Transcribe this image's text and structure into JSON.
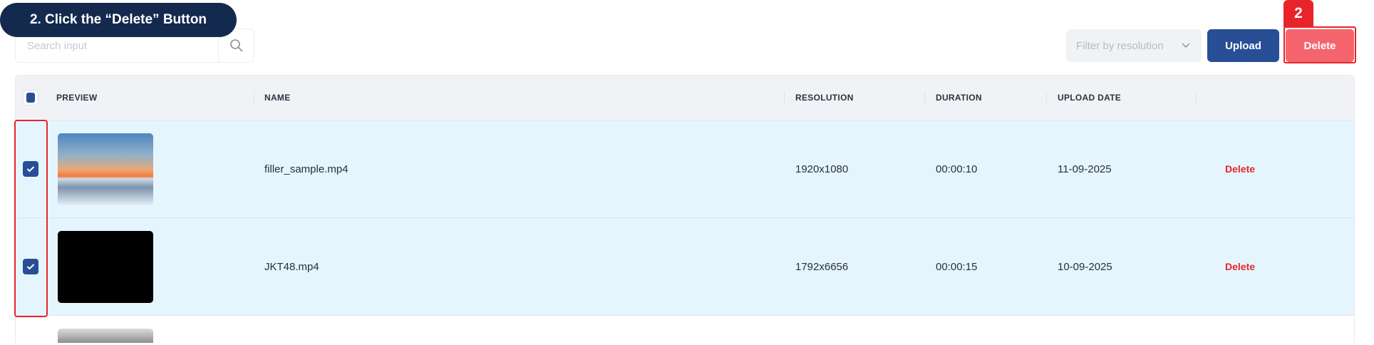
{
  "tooltip": "2. Click the “Delete” Button",
  "badge": "2",
  "search": {
    "placeholder": "Search input",
    "value": ""
  },
  "filter": {
    "placeholder": "Filter by resolution"
  },
  "toolbar": {
    "upload_label": "Upload",
    "delete_label": "Delete"
  },
  "table": {
    "headers": {
      "preview": "PREVIEW",
      "name": "NAME",
      "resolution": "RESOLUTION",
      "duration": "DURATION",
      "upload_date": "UPLOAD DATE"
    },
    "rows": [
      {
        "name": "filler_sample.mp4",
        "resolution": "1920x1080",
        "duration": "00:00:10",
        "upload_date": "11-09-2025",
        "action": "Delete",
        "checked": true
      },
      {
        "name": "JKT48.mp4",
        "resolution": "1792x6656",
        "duration": "00:00:15",
        "upload_date": "10-09-2025",
        "action": "Delete",
        "checked": true
      }
    ]
  },
  "colors": {
    "primary": "#284e96",
    "danger": "#f5656e",
    "highlight": "#e8242a",
    "selected_row": "#e5f5fe"
  }
}
